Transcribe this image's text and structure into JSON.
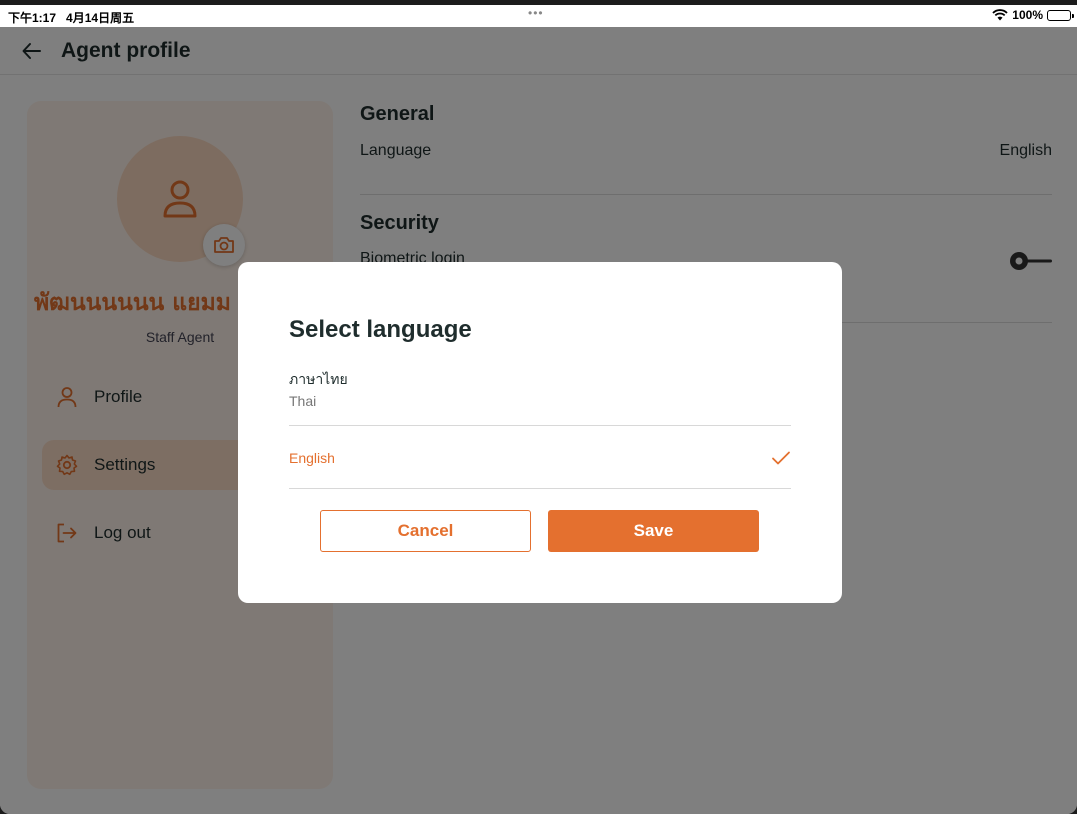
{
  "status_bar": {
    "time": "下午1:17",
    "date": "4月14日周五",
    "dots": "•••",
    "battery": "100%"
  },
  "header": {
    "title": "Agent profile"
  },
  "profile": {
    "name": "พัฒนนนนนน แยมม",
    "role": "Staff Agent"
  },
  "menu": {
    "items": [
      {
        "label": "Profile",
        "icon": "user-icon",
        "active": false
      },
      {
        "label": "Settings",
        "icon": "gear-icon",
        "active": true
      },
      {
        "label": "Log out",
        "icon": "logout-icon",
        "active": false
      }
    ]
  },
  "settings": {
    "general": {
      "title": "General",
      "language_label": "Language",
      "language_value": "English"
    },
    "security": {
      "title": "Security",
      "biometric_label": "Biometric login",
      "biometric_enabled": false
    }
  },
  "modal": {
    "title": "Select language",
    "options": [
      {
        "native": "ภาษาไทย",
        "english": "Thai",
        "selected": false
      },
      {
        "label": "English",
        "selected": true
      }
    ],
    "cancel_label": "Cancel",
    "save_label": "Save"
  },
  "colors": {
    "accent": "#e4702f",
    "accent_light": "#fbdcc6",
    "card_bg": "#fff3ea",
    "text_dark": "#1f2d2d"
  }
}
